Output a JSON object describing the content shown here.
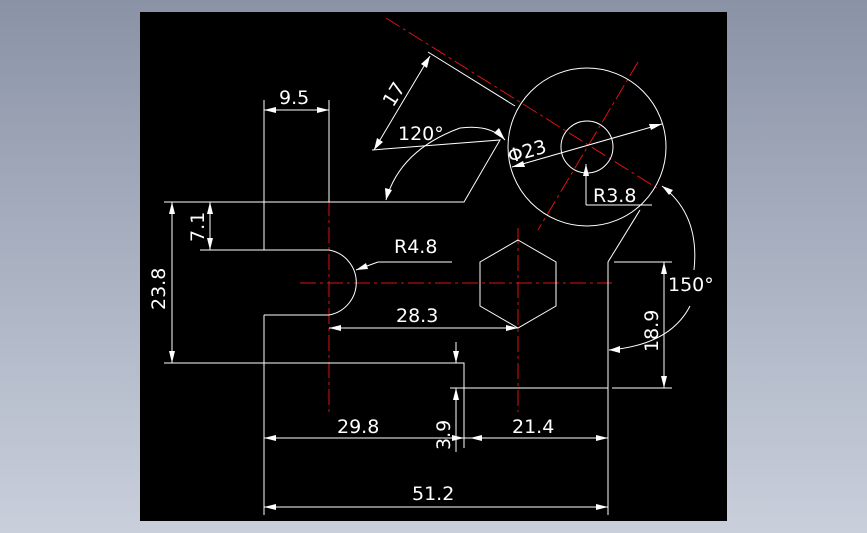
{
  "drawing": {
    "background": "#000000",
    "line_color": "#ffffff",
    "centerline_color": "#e01010",
    "dimensions": {
      "d_9_5": "9.5",
      "d_17": "17",
      "d_120": "120°",
      "d_phi23": "Φ23",
      "d_r38": "R3.8",
      "d_7_1": "7.1",
      "d_23_8": "23.8",
      "d_r48": "R4.8",
      "d_150": "150°",
      "d_28_3": "28.3",
      "d_18_9": "18.9",
      "d_29_8": "29.8",
      "d_3_9": "3.9",
      "d_21_4": "21.4",
      "d_51_2": "51.2"
    }
  }
}
